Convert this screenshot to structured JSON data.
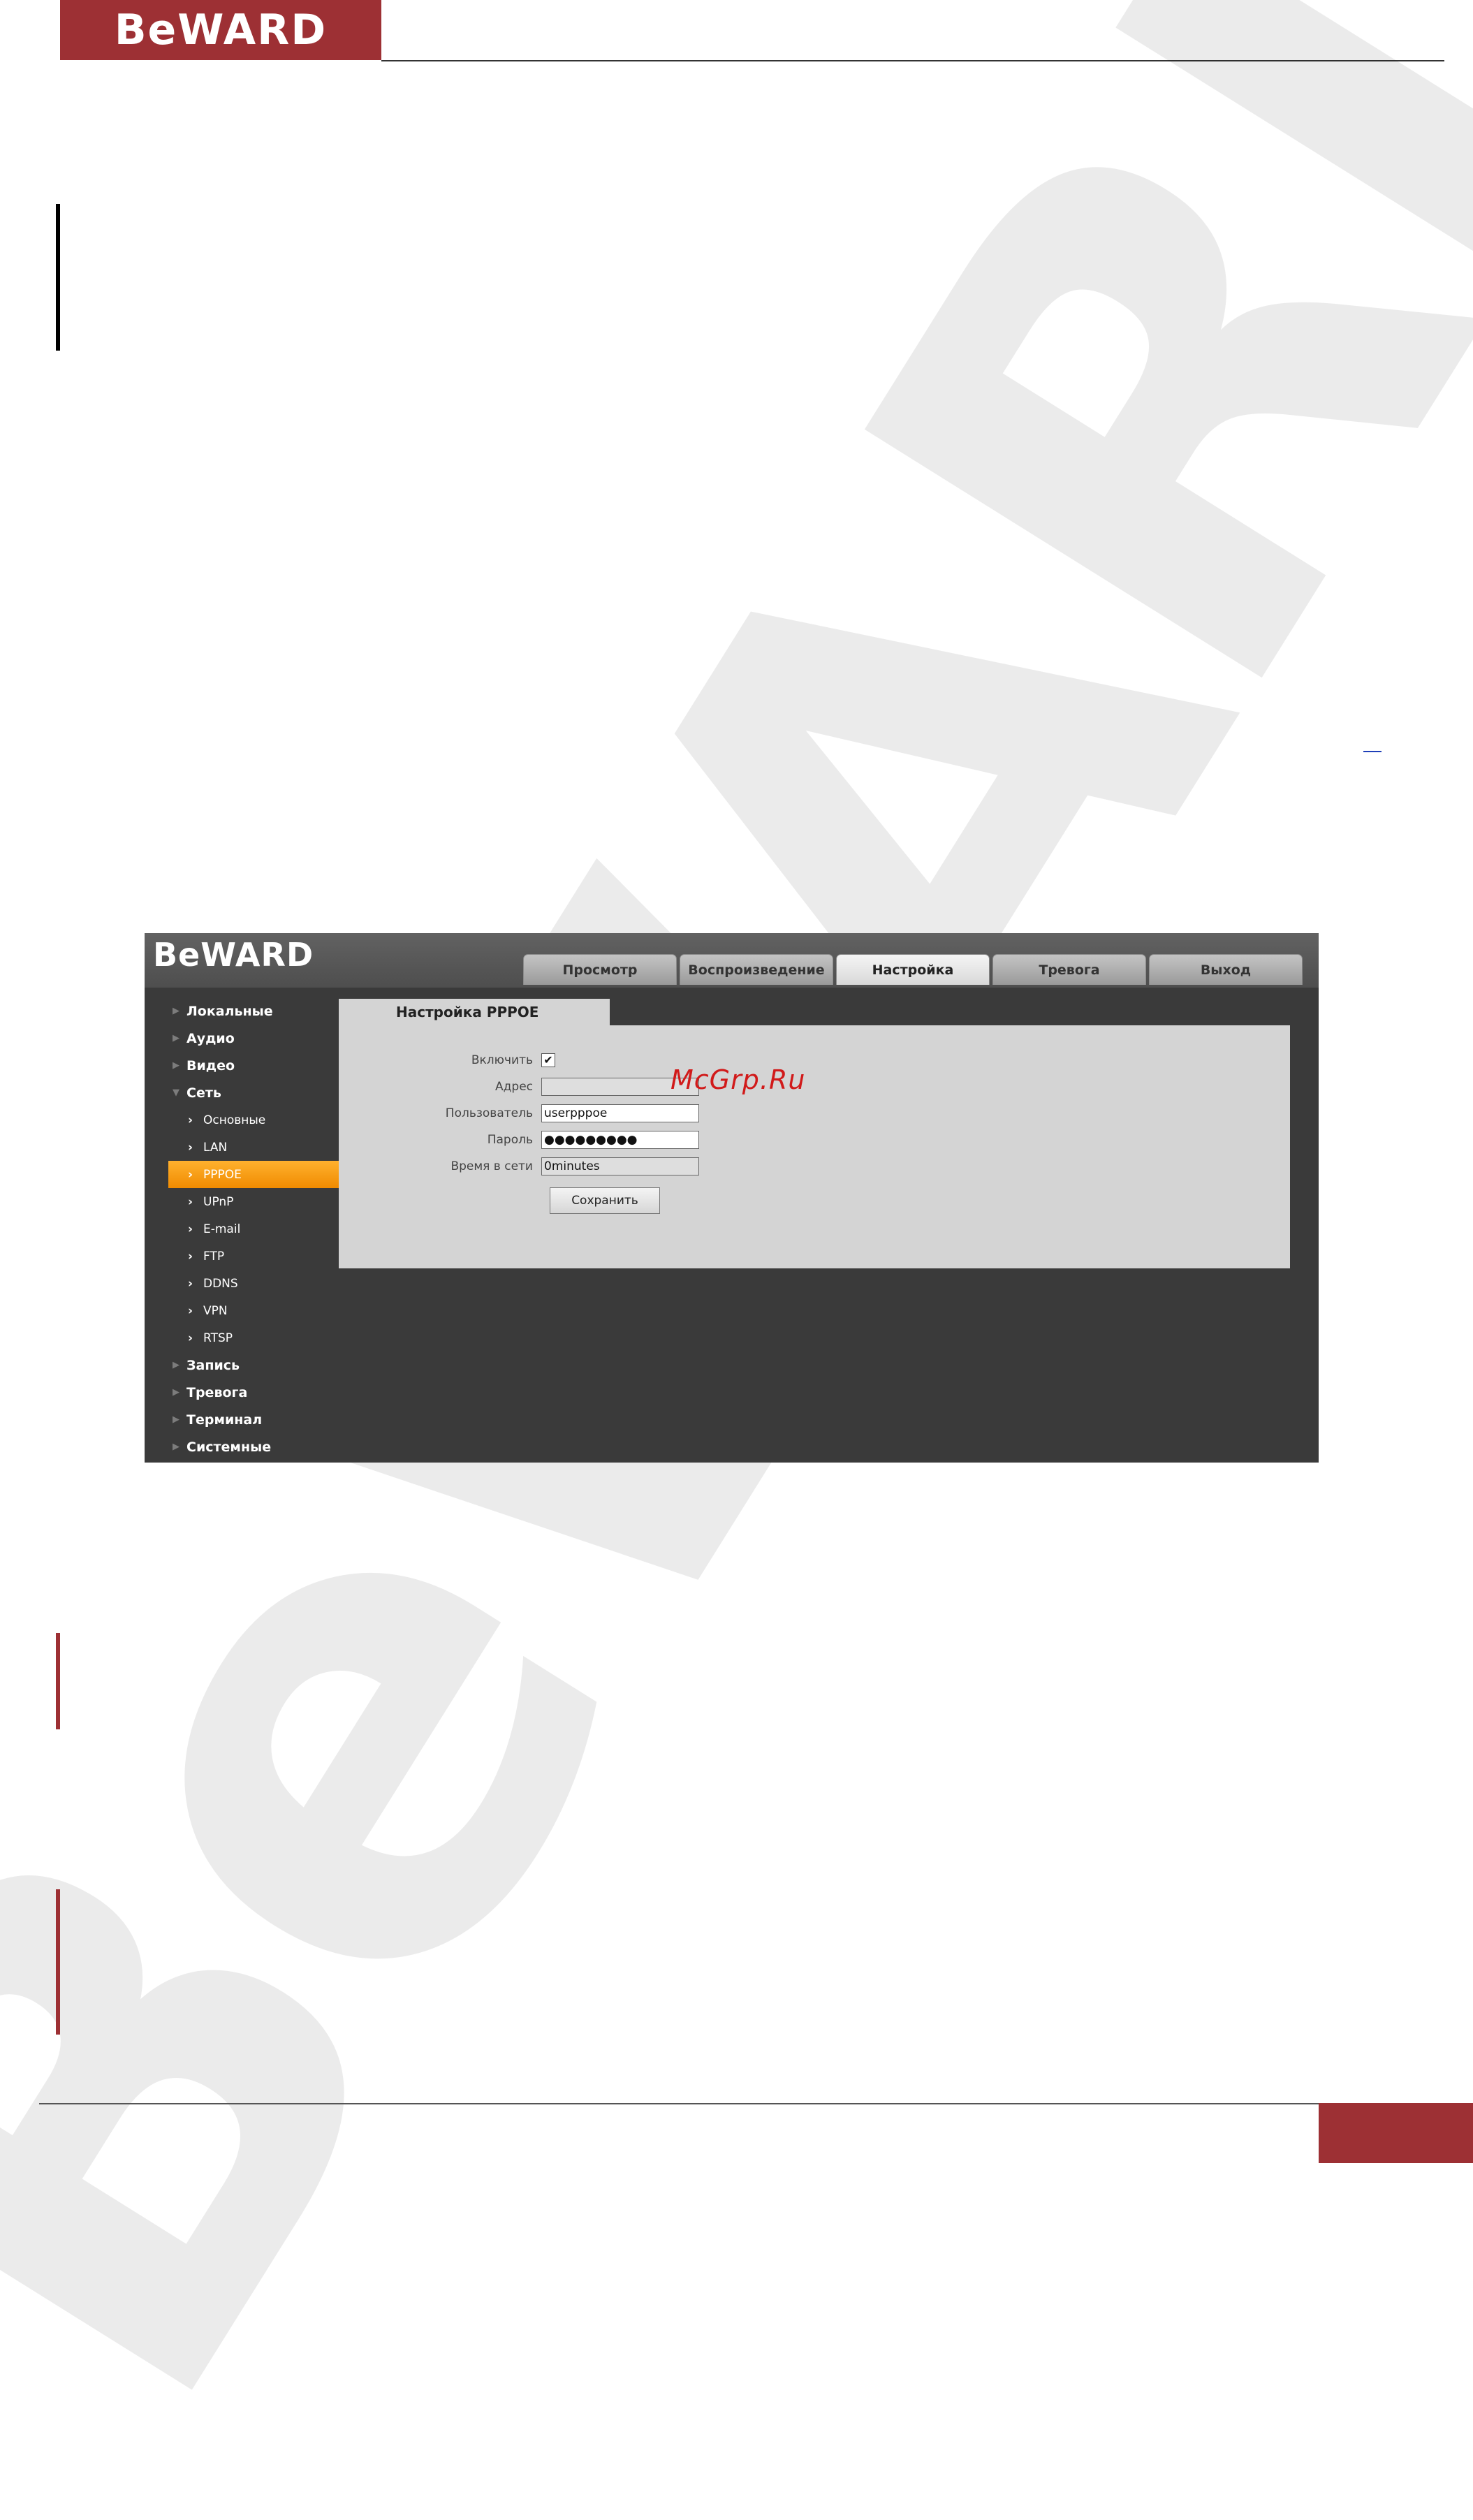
{
  "page": {
    "brand_logo": "BeWARD",
    "watermark_text": "BeWARD",
    "site_watermark": "McGrp.Ru"
  },
  "app": {
    "logo": "BeWARD",
    "tabs": [
      {
        "label": "Просмотр"
      },
      {
        "label": "Воспроизведение"
      },
      {
        "label": "Настройка",
        "active": true
      },
      {
        "label": "Тревога"
      },
      {
        "label": "Выход"
      }
    ],
    "sidebar": [
      {
        "label": "Локальные"
      },
      {
        "label": "Аудио"
      },
      {
        "label": "Видео"
      },
      {
        "label": "Сеть",
        "expanded": true
      },
      {
        "label": "Основные"
      },
      {
        "label": "LAN"
      },
      {
        "label": "PPPOE",
        "selected": true
      },
      {
        "label": "UPnP"
      },
      {
        "label": "E-mail"
      },
      {
        "label": "FTP"
      },
      {
        "label": "DDNS"
      },
      {
        "label": "VPN"
      },
      {
        "label": "RTSP"
      },
      {
        "label": "Запись"
      },
      {
        "label": "Тревога"
      },
      {
        "label": "Терминал"
      },
      {
        "label": "Системные"
      }
    ],
    "panel": {
      "title": "Настройка PPPOE",
      "enable_label": "Включить",
      "enable_checked": true,
      "address_label": "Адрес",
      "address_value": "",
      "user_label": "Пользователь",
      "user_value": "userpppoe",
      "password_label": "Пароль",
      "password_value": "●●●●●●●●●",
      "online_label": "Время в сети",
      "online_value": "0minutes",
      "save_label": "Сохранить"
    }
  },
  "colors": {
    "brand_red": "#9d3034",
    "app_bg": "#3a3a3a",
    "panel_bg": "#d4d4d4",
    "selected_orange": "#f59500"
  }
}
